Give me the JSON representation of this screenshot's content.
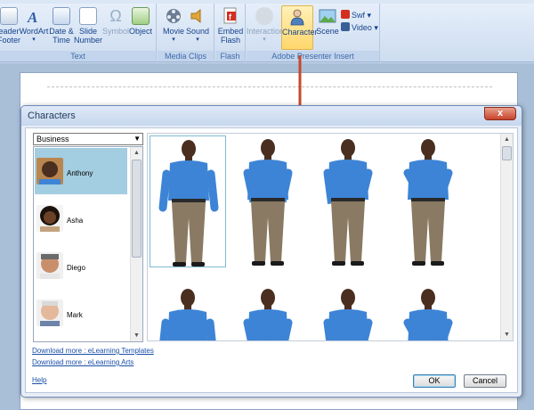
{
  "ribbon": {
    "groups": {
      "text": {
        "label": "Text",
        "buttons": {
          "header_footer": "eader\nFooter",
          "wordart": "WordArt",
          "date_time": "Date &\nTime",
          "slide_number": "Slide\nNumber",
          "symbol": "Symbol",
          "object": "Object"
        }
      },
      "media_clips": {
        "label": "Media Clips",
        "buttons": {
          "movie": "Movie",
          "sound": "Sound"
        }
      },
      "flash": {
        "label": "Flash",
        "buttons": {
          "embed_flash": "Embed\nFlash"
        }
      },
      "presenter": {
        "label": "Adobe Presenter Insert",
        "buttons": {
          "interaction": "Interaction",
          "character": "Character",
          "scene": "Scene",
          "swf": "Swf",
          "video": "Video"
        }
      }
    }
  },
  "dialog": {
    "title": "Characters",
    "close": "x",
    "category": "Business",
    "characters": [
      {
        "name": "Anthony",
        "selected": true
      },
      {
        "name": "Asha",
        "selected": false
      },
      {
        "name": "Diego",
        "selected": false
      },
      {
        "name": "Mark",
        "selected": false
      }
    ],
    "links": {
      "templates": "Download more : eLearning Templates",
      "arts": "Download more : eLearning Arts",
      "help": "Help"
    },
    "buttons": {
      "ok": "OK",
      "cancel": "Cancel"
    }
  },
  "colors": {
    "shirt": "#3d84d6",
    "pants": "#8a7a63",
    "skin": "#4a2e1f",
    "arrow": "#c8472b",
    "selection": "#a3cde0"
  }
}
